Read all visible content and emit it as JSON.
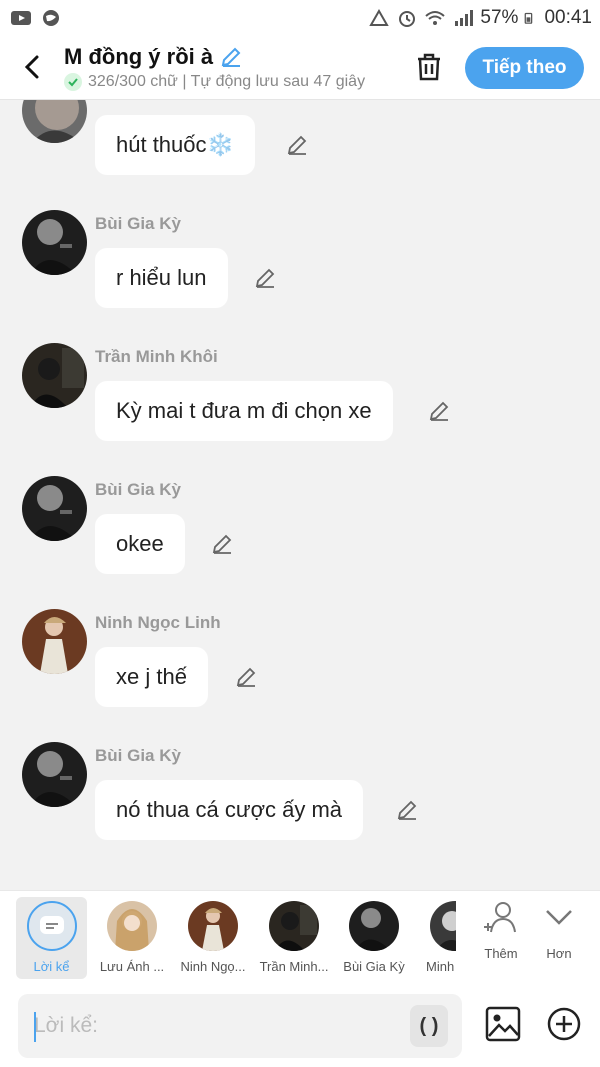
{
  "status_bar": {
    "battery": "57%",
    "time": "00:41"
  },
  "header": {
    "title": "M đồng ý rồi à",
    "subtitle": "326/300 chữ | Tự động lưu sau 47 giây",
    "next_label": "Tiếp theo"
  },
  "messages": [
    {
      "sender": "",
      "text": "hút thuốc❄️"
    },
    {
      "sender": "Bùi Gia Kỳ",
      "text": "r hiểu lun"
    },
    {
      "sender": "Trần Minh Khôi",
      "text": "Kỳ mai t đưa m đi chọn xe"
    },
    {
      "sender": "Bùi Gia Kỳ",
      "text": "okee"
    },
    {
      "sender": "Ninh Ngọc Linh",
      "text": "xe j thế"
    },
    {
      "sender": "Bùi Gia Kỳ",
      "text": "nó thua cá cược ấy mà"
    }
  ],
  "characters": {
    "narrator": "Lời kể",
    "names": [
      "Lưu Ánh ...",
      "Ninh Ngọ...",
      "Trần Minh...",
      "Bùi Gia Kỳ",
      "Minh"
    ],
    "add_label": "Thêm",
    "more_label": "Hơn"
  },
  "input": {
    "placeholder": "Lời kể:",
    "paren_label": "( )"
  },
  "colors": {
    "accent": "#4ba3ee",
    "background": "#f2f2f2",
    "bubble": "#ffffff"
  }
}
